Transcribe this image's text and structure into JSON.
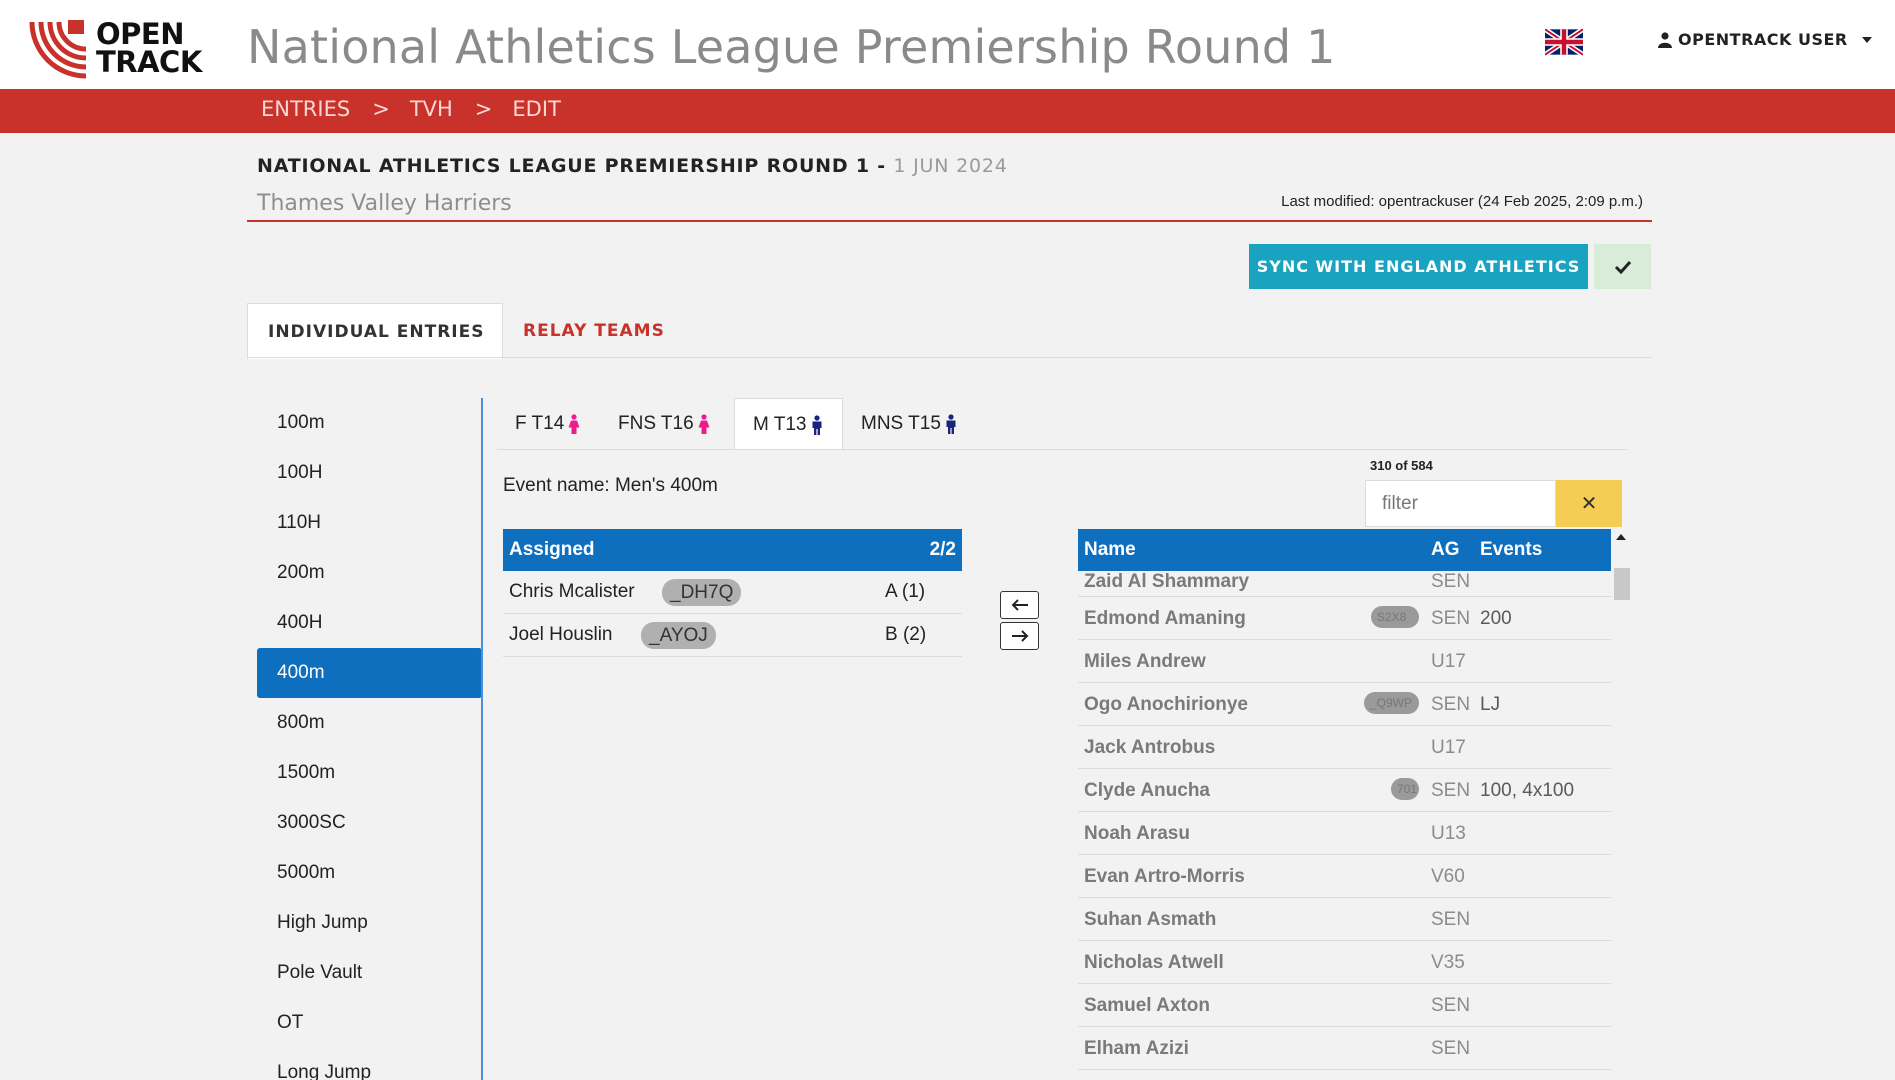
{
  "header": {
    "logo_line1": "OPEN",
    "logo_line2": "TRACK",
    "title": "National Athletics League Premiership Round 1",
    "flag_icon": "uk-flag-icon",
    "user_label": "OPENTRACK USER"
  },
  "breadcrumb": [
    "ENTRIES",
    "TVH",
    "EDIT"
  ],
  "breadcrumb_sep": ">",
  "competition": {
    "name": "NATIONAL ATHLETICS LEAGUE PREMIERSHIP ROUND 1 -",
    "date": "1 JUN 2024",
    "club": "Thames Valley Harriers",
    "last_modified": "Last modified: opentrackuser (24 Feb 2025, 2:09 p.m.)"
  },
  "actions": {
    "sync_label": "SYNC WITH ENGLAND ATHLETICS"
  },
  "tabs": [
    "INDIVIDUAL ENTRIES",
    "RELAY TEAMS"
  ],
  "events": [
    "100m",
    "100H",
    "110H",
    "200m",
    "400H",
    "400m",
    "800m",
    "1500m",
    "3000SC",
    "5000m",
    "High Jump",
    "Pole Vault",
    "OT",
    "Long Jump"
  ],
  "selected_event": "400m",
  "age_tabs": [
    {
      "label": "F T14",
      "gender": "female"
    },
    {
      "label": "FNS T16",
      "gender": "female"
    },
    {
      "label": "M T13",
      "gender": "male"
    },
    {
      "label": "MNS T15",
      "gender": "male"
    }
  ],
  "selected_age_tab": "M T13",
  "event_name": "Event name: Men's 400m",
  "assigned": {
    "header": "Assigned",
    "count": "2/2",
    "rows": [
      {
        "name": "Chris Mcalister",
        "code": "_DH7Q",
        "team": "A (1)"
      },
      {
        "name": "Joel Houslin",
        "code": "_AYOJ",
        "team": "B (2)"
      }
    ]
  },
  "available": {
    "count_label": "310 of 584",
    "filter_placeholder": "filter",
    "clear_label": "✕",
    "columns": [
      "Name",
      "AG",
      "Events"
    ],
    "rows": [
      {
        "name": "Zaid Al Shammary",
        "ag": "SEN",
        "events": "",
        "code": ""
      },
      {
        "name": "Edmond Amaning",
        "ag": "SEN",
        "events": "200",
        "code": "S2X8"
      },
      {
        "name": "Miles Andrew",
        "ag": "U17",
        "events": "",
        "code": ""
      },
      {
        "name": "Ogo Anochirionye",
        "ag": "SEN",
        "events": "LJ",
        "code": "_Q9WP"
      },
      {
        "name": "Jack Antrobus",
        "ag": "U17",
        "events": "",
        "code": ""
      },
      {
        "name": "Clyde Anucha",
        "ag": "SEN",
        "events": "100, 4x100",
        "code": "701"
      },
      {
        "name": "Noah Arasu",
        "ag": "U13",
        "events": "",
        "code": ""
      },
      {
        "name": "Evan Artro-Morris",
        "ag": "V60",
        "events": "",
        "code": ""
      },
      {
        "name": "Suhan Asmath",
        "ag": "SEN",
        "events": "",
        "code": ""
      },
      {
        "name": "Nicholas Atwell",
        "ag": "V35",
        "events": "",
        "code": ""
      },
      {
        "name": "Samuel Axton",
        "ag": "SEN",
        "events": "",
        "code": ""
      },
      {
        "name": "Elham Azizi",
        "ag": "SEN",
        "events": "",
        "code": ""
      }
    ]
  },
  "colors": {
    "brand_red": "#c8322a",
    "primary_blue": "#0f6fbf",
    "sync_teal": "#1aa3c0",
    "female_pink": "#e91e8c",
    "male_navy": "#1a237e",
    "clear_yellow": "#f5cd55"
  }
}
